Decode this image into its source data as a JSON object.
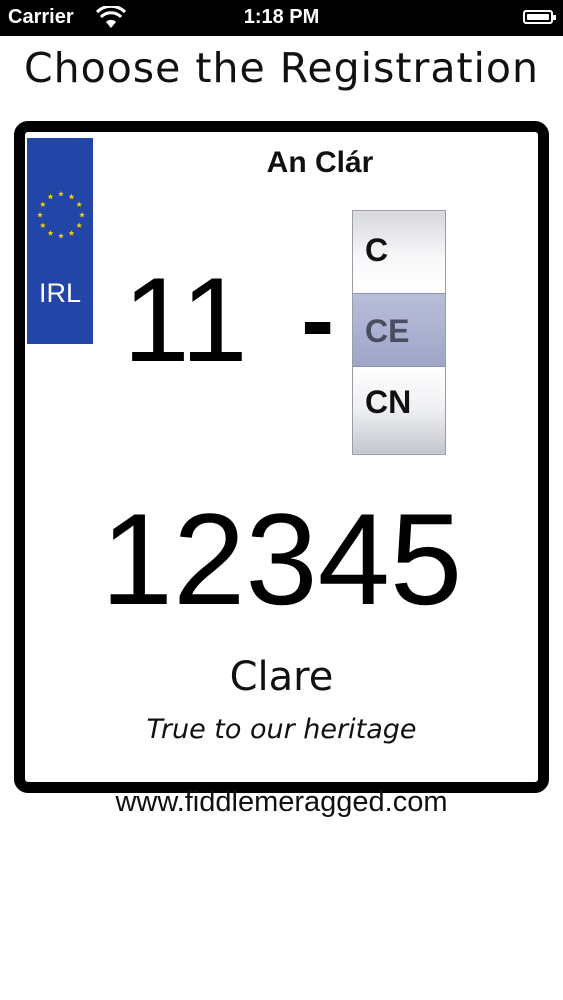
{
  "status_bar": {
    "carrier": "Carrier",
    "time": "1:18 PM"
  },
  "page_title": "Choose the Registration",
  "plate": {
    "eu_band": {
      "country_code": "IRL",
      "band_color": "#2246a8",
      "star_color": "#f5d000"
    },
    "county_irish": "An Clár",
    "year_code": "11",
    "separator": "-",
    "county_picker": {
      "options": [
        "C",
        "CE",
        "CN"
      ],
      "selected": "CE"
    },
    "registration_number": "12345",
    "county_english": "Clare",
    "slogan": "True to our heritage"
  },
  "website": "www.fiddlemeragged.com"
}
